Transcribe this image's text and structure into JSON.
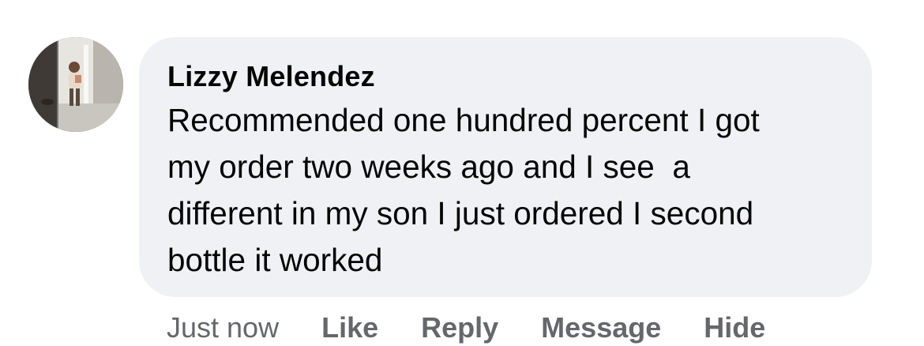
{
  "comment": {
    "author": "Lizzy Melendez",
    "text": "Recommended one hundred percent I got\nmy order two weeks ago and I see  a\ndifferent in my son I just ordered I second\nbottle it worked",
    "avatar_icon": "user-avatar-photo"
  },
  "actions": {
    "timestamp": "Just now",
    "like_label": "Like",
    "reply_label": "Reply",
    "message_label": "Message",
    "hide_label": "Hide"
  },
  "colors": {
    "bubble_bg": "#f0f1f5",
    "text": "#050505",
    "secondary_text": "#65676b"
  }
}
